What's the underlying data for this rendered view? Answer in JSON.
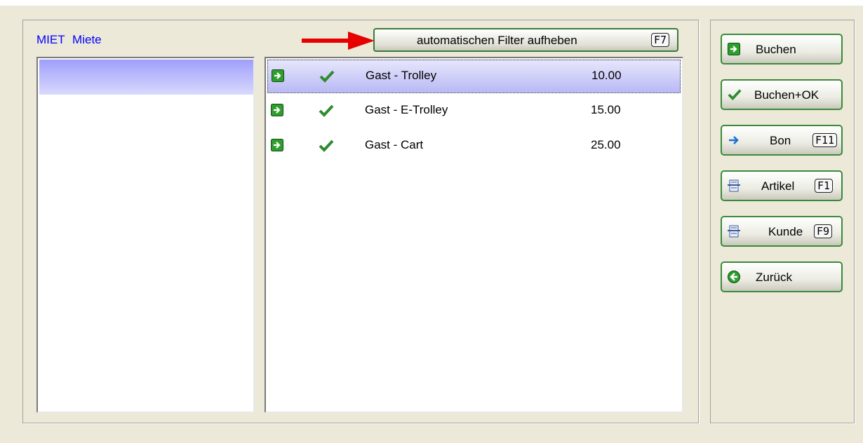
{
  "group": {
    "code": "MIET",
    "name": "Miete"
  },
  "filter_button": {
    "label": "automatischen Filter aufheben",
    "key": "F7"
  },
  "items": [
    {
      "name": "Gast - Trolley",
      "price": "10.00",
      "selected": true
    },
    {
      "name": "Gast - E-Trolley",
      "price": "15.00",
      "selected": false
    },
    {
      "name": "Gast - Cart",
      "price": "25.00",
      "selected": false
    }
  ],
  "side_buttons": {
    "buchen": {
      "label": "Buchen",
      "icon": "green-arrow-icon"
    },
    "buchen_ok": {
      "label": "Buchen+OK",
      "icon": "checkmark-icon"
    },
    "bon": {
      "label": "Bon",
      "key": "F11",
      "icon": "blue-arrow-icon"
    },
    "artikel": {
      "label": "Artikel",
      "key": "F1",
      "icon": "document-icon"
    },
    "kunde": {
      "label": "Kunde",
      "key": "F9",
      "icon": "document-icon"
    },
    "zurueck": {
      "label": "Zurück",
      "icon": "back-circle-icon"
    }
  },
  "colors": {
    "accent_green": "#2e8b2e",
    "selection": "#b9b9f5",
    "caption_blue": "#0000ff",
    "arrow_red": "#e60000"
  }
}
